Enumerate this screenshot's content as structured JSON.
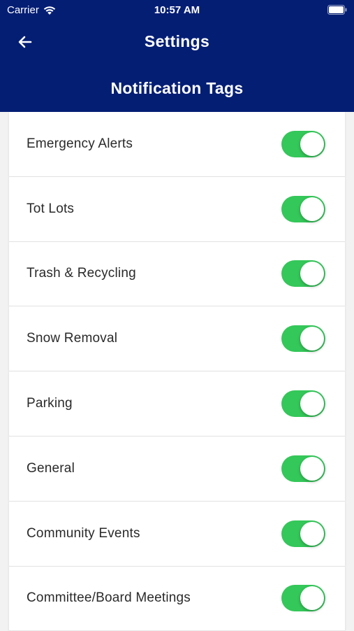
{
  "status_bar": {
    "carrier": "Carrier",
    "time": "10:57 AM",
    "icons": [
      "wifi-icon",
      "battery-icon"
    ]
  },
  "nav": {
    "back_icon": "arrow-left-icon",
    "title": "Settings"
  },
  "section": {
    "title": "Notification Tags"
  },
  "colors": {
    "header_bg": "#041e74",
    "toggle_on": "#34c759"
  },
  "items": [
    {
      "label": "Emergency Alerts",
      "enabled": true
    },
    {
      "label": "Tot Lots",
      "enabled": true
    },
    {
      "label": "Trash & Recycling",
      "enabled": true
    },
    {
      "label": "Snow Removal",
      "enabled": true
    },
    {
      "label": "Parking",
      "enabled": true
    },
    {
      "label": "General",
      "enabled": true
    },
    {
      "label": "Community Events",
      "enabled": true
    },
    {
      "label": "Committee/Board Meetings",
      "enabled": true
    }
  ]
}
